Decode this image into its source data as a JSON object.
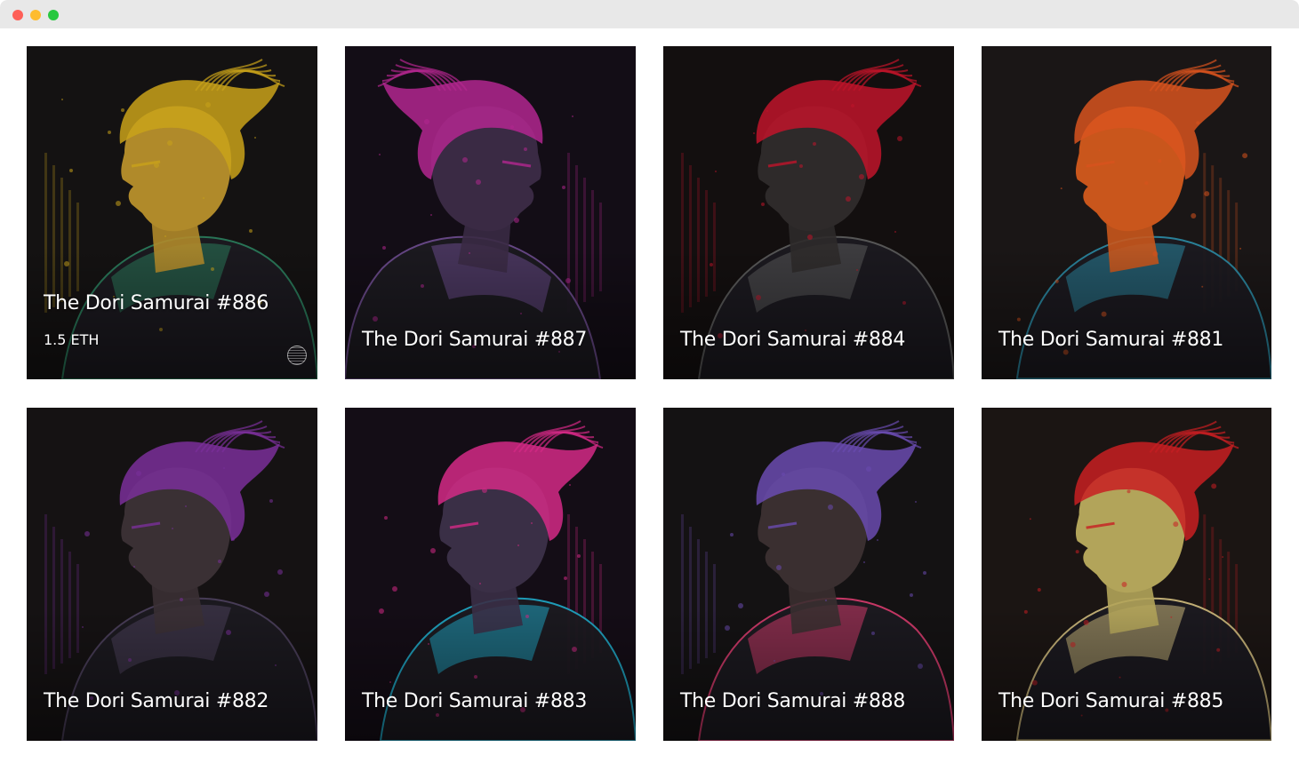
{
  "window": {
    "controls": [
      "close",
      "minimize",
      "maximize"
    ]
  },
  "gallery": {
    "items": [
      {
        "title": "The Dori Samurai #886",
        "price": "1.5 ETH",
        "palette": {
          "bg": "#141212",
          "accent": "#c9a21a",
          "accent2": "#2a7a5a",
          "skin": "#b08a2a"
        },
        "art": "yellow-hair-samurai-profile"
      },
      {
        "title": "The Dori Samurai #887",
        "palette": {
          "bg": "#130d16",
          "accent": "#b3278f",
          "accent2": "#6a4a8a",
          "skin": "#3a2a44"
        },
        "art": "helmet-samurai-back-view"
      },
      {
        "title": "The Dori Samurai #884",
        "palette": {
          "bg": "#130f0f",
          "accent": "#c0142a",
          "accent2": "#5a5a5a",
          "skin": "#2e2a2a"
        },
        "art": "masked-samurai-red-profile"
      },
      {
        "title": "The Dori Samurai #881",
        "palette": {
          "bg": "#1a1616",
          "accent": "#d8531e",
          "accent2": "#2a86a0",
          "skin": "#c9561c"
        },
        "art": "orange-teal-samurai-profile"
      },
      {
        "title": "The Dori Samurai #882",
        "palette": {
          "bg": "#151213",
          "accent": "#7a2f9a",
          "accent2": "#4a3f5a",
          "skin": "#3a3034"
        },
        "art": "purple-topknot-samurai-profile"
      },
      {
        "title": "The Dori Samurai #883",
        "palette": {
          "bg": "#140d16",
          "accent": "#d42a86",
          "accent2": "#1fa3c0",
          "skin": "#3a2f46"
        },
        "art": "masked-headphone-samurai"
      },
      {
        "title": "The Dori Samurai #888",
        "palette": {
          "bg": "#141213",
          "accent": "#6a4bb0",
          "accent2": "#d03a6a",
          "skin": "#3a2f30"
        },
        "art": "topknot-samurai-dark-profile"
      },
      {
        "title": "The Dori Samurai #885",
        "palette": {
          "bg": "#1b1513",
          "accent": "#c81e22",
          "accent2": "#c9b67a",
          "skin": "#b2a45a"
        },
        "art": "red-cream-samurai-with-swords"
      }
    ]
  }
}
